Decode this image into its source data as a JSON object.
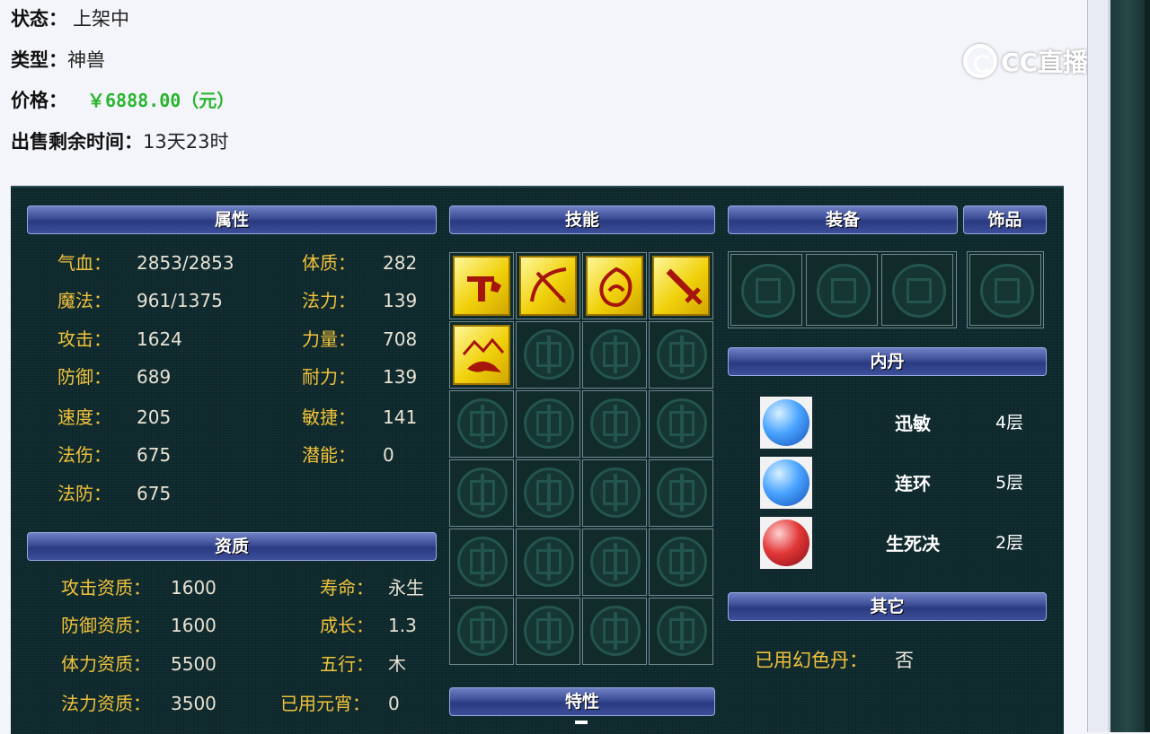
{
  "info": {
    "status_label": "状态：",
    "status_value": "上架中",
    "type_label": "类型：",
    "type_value": "神兽",
    "price_label": "价格：",
    "price_value": "￥6888.00（元）",
    "time_label": "出售剩余时间：",
    "time_value": "13天23时"
  },
  "watermark": "CC直播",
  "headers": {
    "attributes": "属性",
    "skills": "技能",
    "equipment": "装备",
    "accessory": "饰品",
    "inner_pill": "内丹",
    "aptitude": "资质",
    "other": "其它",
    "traits": "特性"
  },
  "attributes": [
    {
      "label": "气血：",
      "value": "2853/2853"
    },
    {
      "label": "魔法：",
      "value": "961/1375"
    },
    {
      "label": "攻击：",
      "value": "1624"
    },
    {
      "label": "防御：",
      "value": "689"
    },
    {
      "label": "速度：",
      "value": "205"
    },
    {
      "label": "法伤：",
      "value": "675"
    },
    {
      "label": "法防：",
      "value": "675"
    }
  ],
  "attributes_right": [
    {
      "label": "体质：",
      "value": "282"
    },
    {
      "label": "法力：",
      "value": "139"
    },
    {
      "label": "力量：",
      "value": "708"
    },
    {
      "label": "耐力：",
      "value": "139"
    },
    {
      "label": "敏捷：",
      "value": "141"
    },
    {
      "label": "潜能：",
      "value": "0"
    }
  ],
  "aptitude": [
    {
      "label": "攻击资质：",
      "value": "1600"
    },
    {
      "label": "防御资质：",
      "value": "1600"
    },
    {
      "label": "体力资质：",
      "value": "5500"
    },
    {
      "label": "法力资质：",
      "value": "3500"
    }
  ],
  "aptitude_right": [
    {
      "label": "寿命：",
      "value": "永生"
    },
    {
      "label": "成长：",
      "value": "1.3"
    },
    {
      "label": "五行：",
      "value": "木"
    },
    {
      "label": "已用元宵：",
      "value": "0"
    }
  ],
  "skills": [
    "skill-icon-1",
    "skill-icon-2",
    "skill-icon-3",
    "skill-icon-4",
    "skill-icon-5"
  ],
  "inner_pills": [
    {
      "name": "迅敏",
      "level": "4层",
      "color": "#2c86e0"
    },
    {
      "name": "连环",
      "level": "5层",
      "color": "#2c86e0"
    },
    {
      "name": "生死决",
      "level": "2层",
      "color": "#d0222a"
    }
  ],
  "other": {
    "label": "已用幻色丹：",
    "value": "否"
  },
  "colors": {
    "label_gold": "#f1c23a",
    "price_green": "#29b52e",
    "header_blue": "#3b4c95"
  }
}
